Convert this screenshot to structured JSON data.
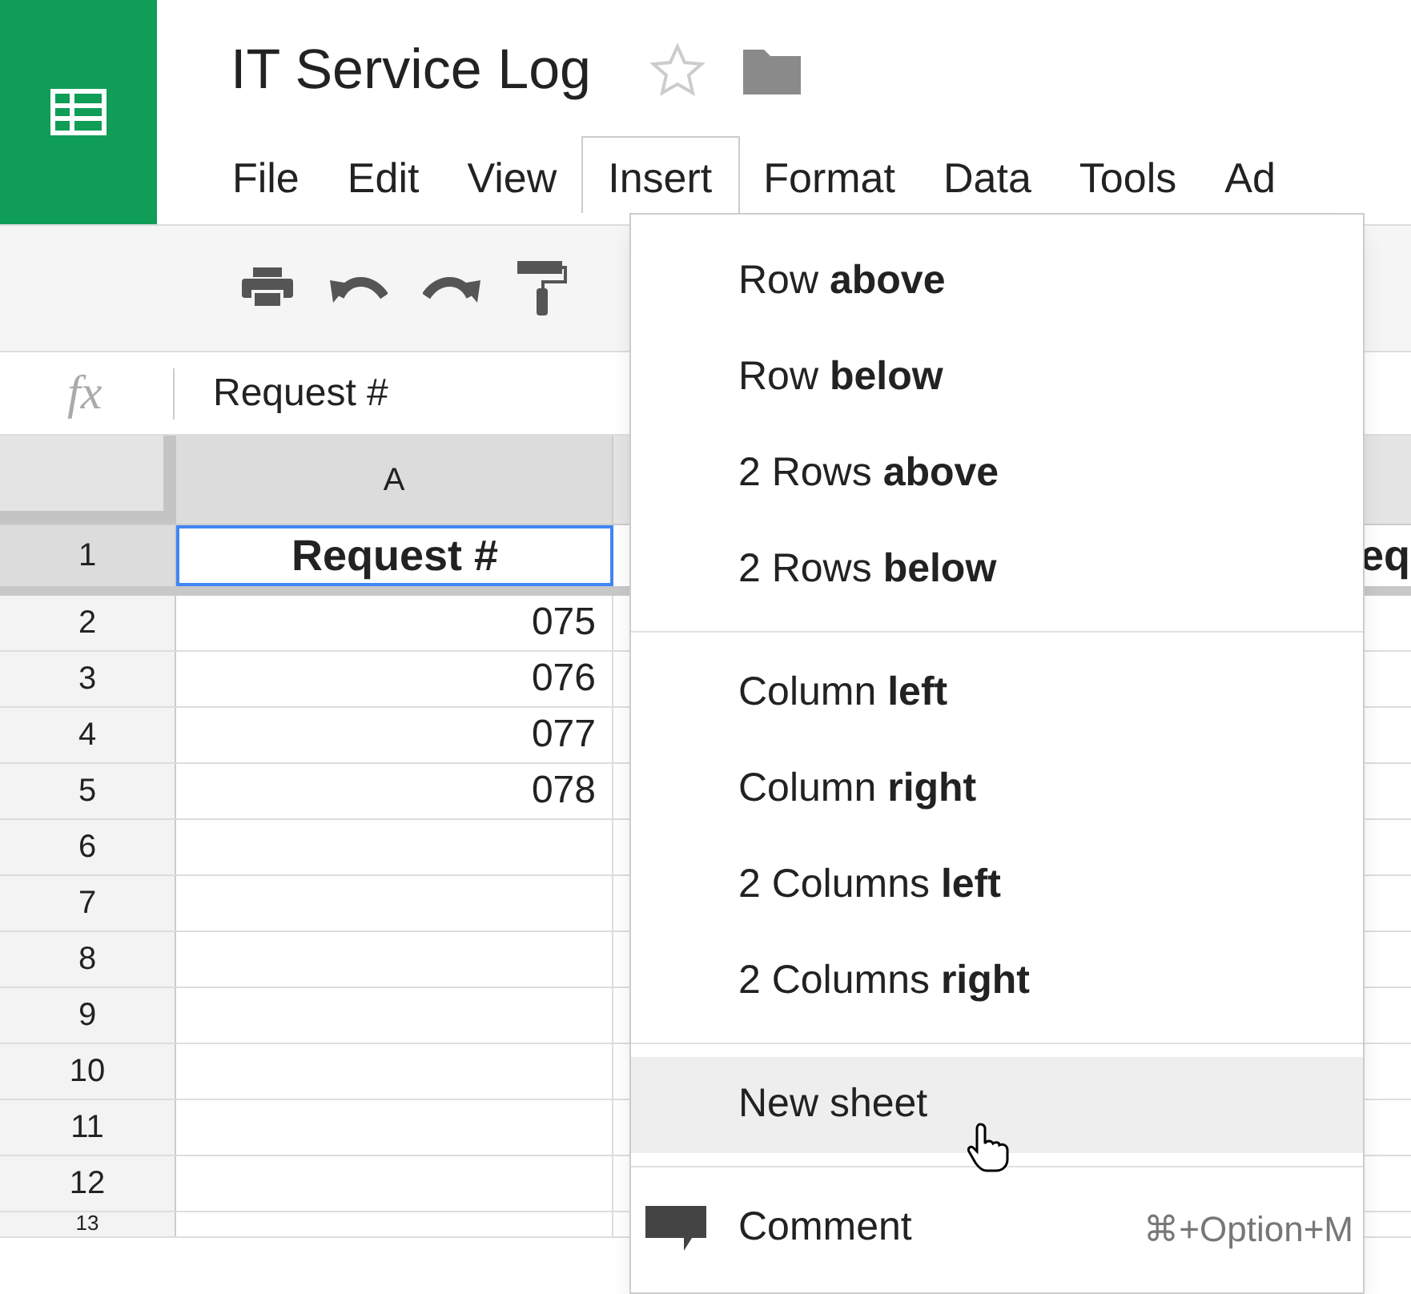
{
  "app": {
    "title": "IT Service Log",
    "starred": false
  },
  "menu_bar": [
    {
      "label": "File",
      "selected": false
    },
    {
      "label": "Edit",
      "selected": false
    },
    {
      "label": "View",
      "selected": false
    },
    {
      "label": "Insert",
      "selected": true
    },
    {
      "label": "Format",
      "selected": false
    },
    {
      "label": "Data",
      "selected": false
    },
    {
      "label": "Tools",
      "selected": false
    },
    {
      "label": "Ad",
      "selected": false
    }
  ],
  "formula_bar": {
    "label": "fx",
    "value": "Request #"
  },
  "column_headers": [
    "A"
  ],
  "rows": [
    {
      "number": "1",
      "column_a": "Request #",
      "column_c": "eq",
      "selected": true
    },
    {
      "number": "2",
      "column_a": "075",
      "selected": false
    },
    {
      "number": "3",
      "column_a": "076",
      "selected": false
    },
    {
      "number": "4",
      "column_a": "077",
      "selected": false
    },
    {
      "number": "5",
      "column_a": "078",
      "selected": false
    },
    {
      "number": "6",
      "selected": false
    },
    {
      "number": "7",
      "selected": false
    },
    {
      "number": "8",
      "selected": false
    },
    {
      "number": "9",
      "selected": false
    },
    {
      "number": "10",
      "selected": false
    },
    {
      "number": "11",
      "selected": false
    },
    {
      "number": "12",
      "selected": false
    },
    {
      "number": "13",
      "selected": false
    }
  ],
  "insert_menu": {
    "sections": [
      [
        {
          "kind": "text",
          "label": "Row **above**",
          "hovered": false
        },
        {
          "kind": "text",
          "label": "Row **below**",
          "hovered": false
        },
        {
          "kind": "text",
          "label": "2 Rows **above**",
          "hovered": false
        },
        {
          "kind": "text",
          "label": "2 Rows **below**",
          "hovered": false
        }
      ],
      [
        {
          "kind": "text",
          "label": "Column **left**",
          "hovered": false
        },
        {
          "kind": "text",
          "label": "Column **right**",
          "hovered": false
        },
        {
          "kind": "text",
          "label": "2 Columns **left**",
          "hovered": false
        },
        {
          "kind": "text",
          "label": "2 Columns **right**",
          "hovered": false
        }
      ],
      [
        {
          "kind": "text",
          "label": "New sheet",
          "hovered": true
        }
      ],
      [
        {
          "kind": "comment",
          "label": "Comment",
          "shortcut": "⌘+Option+M",
          "hovered": false
        }
      ]
    ]
  }
}
